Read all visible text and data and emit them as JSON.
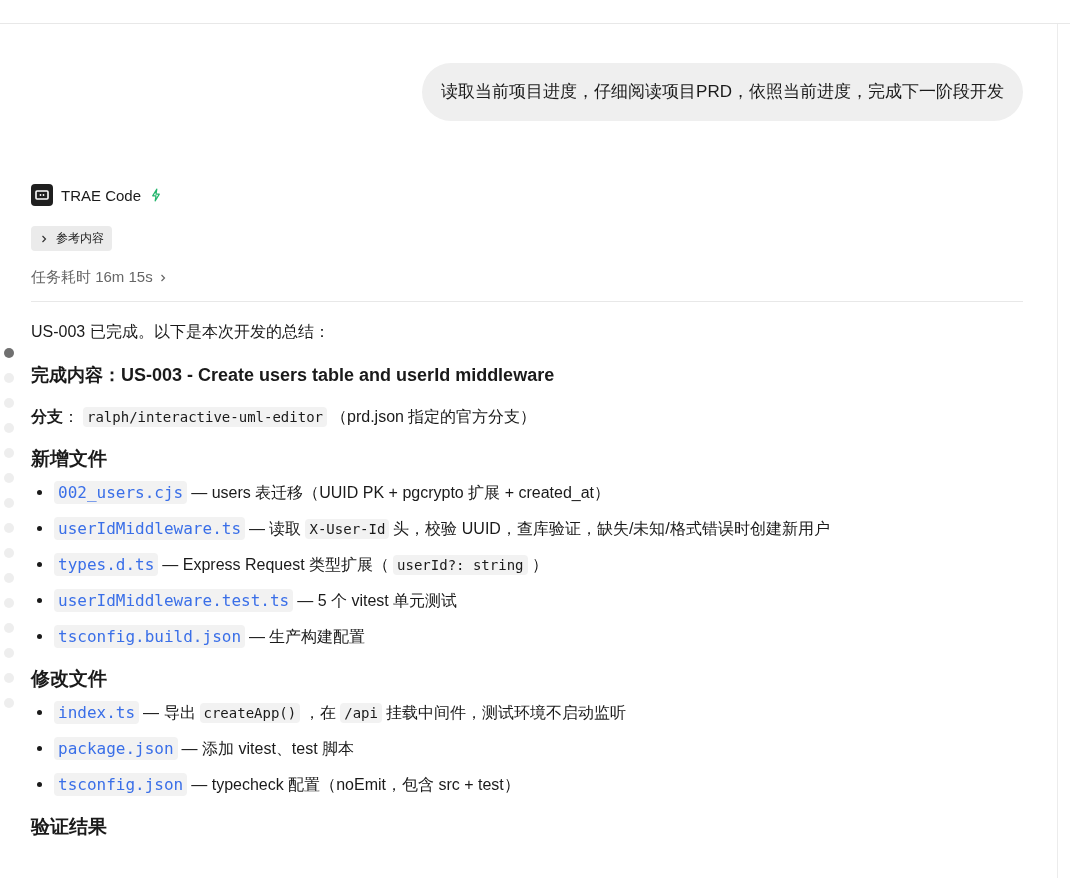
{
  "user_message": "读取当前项目进度，仔细阅读项目PRD，依照当前进度，完成下一阶段开发",
  "assistant": {
    "name": "TRAE Code",
    "reference_toggle": {
      "label": "参考内容",
      "expanded": false
    },
    "duration": "任务耗时 16m 15s"
  },
  "timeline_dots": [
    {
      "selected": true
    },
    {
      "selected": false
    },
    {
      "selected": false
    },
    {
      "selected": false
    },
    {
      "selected": false
    },
    {
      "selected": false
    },
    {
      "selected": false
    },
    {
      "selected": false
    },
    {
      "selected": false
    },
    {
      "selected": false
    },
    {
      "selected": false
    },
    {
      "selected": false
    },
    {
      "selected": false
    },
    {
      "selected": false
    },
    {
      "selected": false
    }
  ],
  "blocks": [
    {
      "kind": "paragraph",
      "segments": [
        {
          "kind": "text",
          "text": "US-003 已完成。以下是本次开发的总结："
        }
      ]
    },
    {
      "kind": "strong",
      "segments": [
        {
          "kind": "text",
          "text": "完成内容：US-003 - Create users table and userId middleware"
        }
      ]
    },
    {
      "kind": "paragraph",
      "segments": [
        {
          "kind": "bold",
          "text": "分支"
        },
        {
          "kind": "text",
          "text": "："
        },
        {
          "kind": "code",
          "text": "ralph/interactive-uml-editor"
        },
        {
          "kind": "text",
          "text": "（prd.json 指定的官方分支）"
        }
      ]
    },
    {
      "kind": "heading",
      "segments": [
        {
          "kind": "text",
          "text": "新增文件"
        }
      ]
    },
    {
      "kind": "list",
      "items": [
        [
          {
            "kind": "file",
            "text": "002_users.cjs"
          },
          {
            "kind": "text",
            "text": "— users 表迁移（UUID PK + pgcrypto 扩展 + created_at）"
          }
        ],
        [
          {
            "kind": "file",
            "text": "userIdMiddleware.ts"
          },
          {
            "kind": "text",
            "text": "— 读取"
          },
          {
            "kind": "code",
            "text": "X-User-Id"
          },
          {
            "kind": "text",
            "text": "头，校验 UUID，查库验证，缺失/未知/格式错误时创建新用户"
          }
        ],
        [
          {
            "kind": "file",
            "text": "types.d.ts"
          },
          {
            "kind": "text",
            "text": "— Express Request 类型扩展（"
          },
          {
            "kind": "code",
            "text": "userId?: string"
          },
          {
            "kind": "text",
            "text": "）"
          }
        ],
        [
          {
            "kind": "file",
            "text": "userIdMiddleware.test.ts"
          },
          {
            "kind": "text",
            "text": "— 5 个 vitest 单元测试"
          }
        ],
        [
          {
            "kind": "file",
            "text": "tsconfig.build.json"
          },
          {
            "kind": "text",
            "text": "— 生产构建配置"
          }
        ]
      ]
    },
    {
      "kind": "heading",
      "segments": [
        {
          "kind": "text",
          "text": "修改文件"
        }
      ]
    },
    {
      "kind": "list",
      "items": [
        [
          {
            "kind": "file",
            "text": "index.ts"
          },
          {
            "kind": "text",
            "text": "— 导出"
          },
          {
            "kind": "code",
            "text": "createApp()"
          },
          {
            "kind": "text",
            "text": "，在"
          },
          {
            "kind": "code",
            "text": "/api"
          },
          {
            "kind": "text",
            "text": "挂载中间件，测试环境不启动监听"
          }
        ],
        [
          {
            "kind": "file",
            "text": "package.json"
          },
          {
            "kind": "text",
            "text": "— 添加 vitest、test 脚本"
          }
        ],
        [
          {
            "kind": "file",
            "text": "tsconfig.json"
          },
          {
            "kind": "text",
            "text": "— typecheck 配置（noEmit，包含 src + test）"
          }
        ]
      ]
    },
    {
      "kind": "heading",
      "segments": [
        {
          "kind": "text",
          "text": "验证结果"
        }
      ]
    }
  ]
}
